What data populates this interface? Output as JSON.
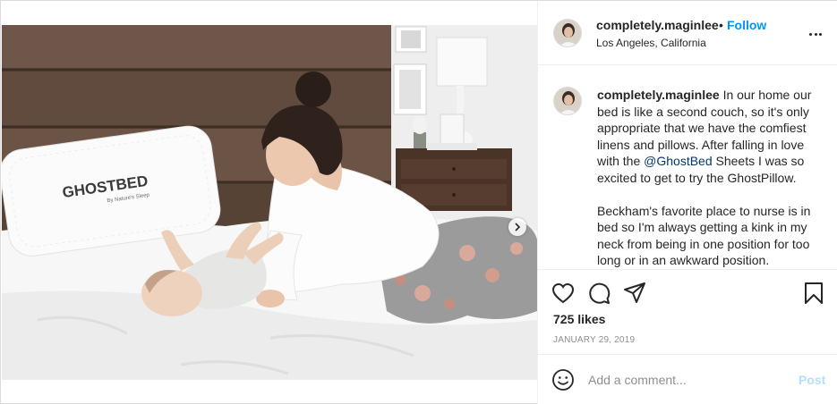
{
  "post": {
    "username": "completely.maginlee",
    "dot": "•",
    "follow_label": "Follow",
    "location": "Los Angeles, California",
    "more_icon": "more-options-icon"
  },
  "photo": {
    "pillow_brand": "GHOSTBED",
    "pillow_tagline": "By Nature's Sleep",
    "carousel_icon": "chevron-right-icon"
  },
  "caption": {
    "username": "completely.maginlee",
    "paragraph1_before": " In our home our bed is like a second couch, so it's only appropriate that we have the comfiest linens and pillows. After falling in love with the ",
    "mention": "@GhostBed",
    "paragraph1_after": " Sheets I was so excited to get to try the GhostPillow.",
    "paragraph2": "Beckham's favorite place to nurse is in bed so I'm always getting a kink in my neck from being in one position for too long or in an awkward position."
  },
  "actions": {
    "icons": [
      "heart-icon",
      "comment-icon",
      "share-icon",
      "bookmark-icon"
    ],
    "likes": "725 likes",
    "date": "JANUARY 29, 2019"
  },
  "comment": {
    "placeholder": "Add a comment...",
    "post_label": "Post",
    "emoji_icon": "emoji-icon"
  }
}
